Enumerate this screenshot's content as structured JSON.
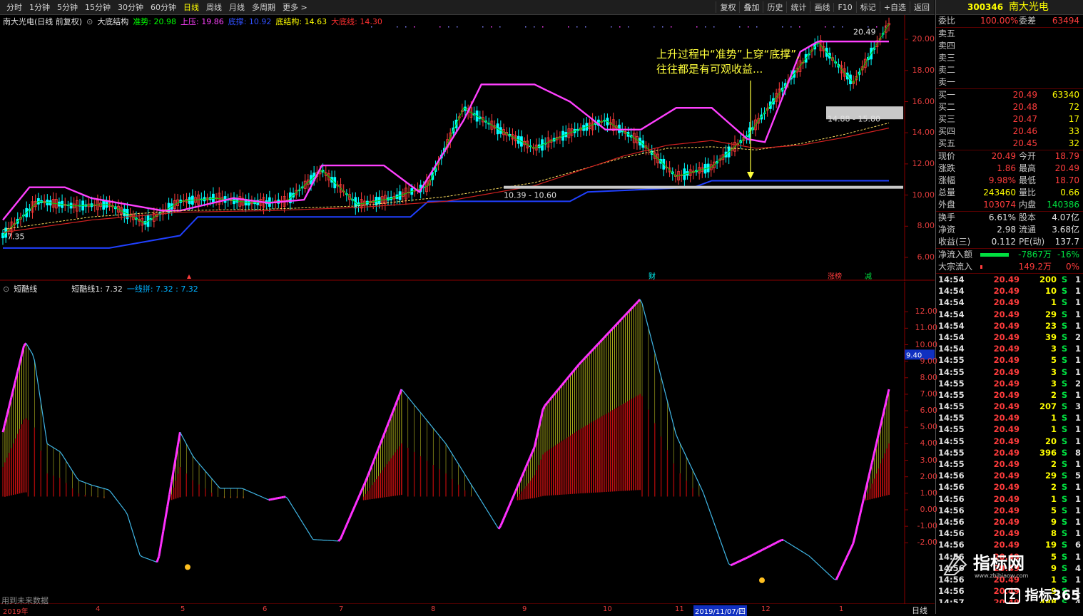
{
  "toolbar": {
    "tabs": [
      "分时",
      "1分钟",
      "5分钟",
      "15分钟",
      "30分钟",
      "60分钟",
      "日线",
      "周线",
      "月线",
      "多周期",
      "更多 >"
    ],
    "active_tab": "日线",
    "buttons": [
      "复权",
      "叠加",
      "历史",
      "统计",
      "画线",
      "F10",
      "标记",
      "+自选",
      "返回"
    ]
  },
  "main_legend": {
    "title": "南大光电(日线 前复权)",
    "indicator": "大底结构",
    "items": [
      {
        "text": "准势: 20.98",
        "color": "#00ff00"
      },
      {
        "text": "上压: 19.86",
        "color": "#ff40ff"
      },
      {
        "text": "底撑: 10.92",
        "color": "#3050ff"
      },
      {
        "text": "底结构: 14.63",
        "color": "#ffff00"
      },
      {
        "text": "大底线: 14.30",
        "color": "#ff3030"
      }
    ]
  },
  "annotation": [
    "上升过程中“准势”上穿“底撑”,",
    "往往都是有可观收益..."
  ],
  "main_axis_labels": [
    "20.00",
    "18.00",
    "16.00",
    "14.00",
    "12.00",
    "10.00",
    "8.00",
    "6.00"
  ],
  "price_marks": {
    "high": "20.49",
    "low": "7.35",
    "zone_high": "14.88 - 15.80",
    "zone_low": "10.39 - 10.60"
  },
  "event_tags": [
    "财",
    "涨榜",
    "减"
  ],
  "indicator_legend": {
    "name": "短酷线",
    "items": [
      {
        "text": "短酷线1: 7.32",
        "color": "#e0e0e0"
      },
      {
        "text": "一线拼: 7.32 : 7.32",
        "color": "#00b0ff"
      }
    ]
  },
  "ind_axis_labels": [
    "12.00",
    "11.00",
    "10.00",
    "9.00",
    "8.00",
    "7.00",
    "6.00",
    "5.00",
    "4.00",
    "3.00",
    "2.00",
    "1.00",
    "0.00",
    "-1.00",
    "-2.00"
  ],
  "ind_marker": "9.40",
  "date_labels": [
    "2019年",
    "4",
    "5",
    "6",
    "7",
    "8",
    "9",
    "10",
    "11",
    "2019/11/07/四",
    "12",
    "1"
  ],
  "bottom_note": "用到未来数据",
  "right_bottom_tab": "日线",
  "quote": {
    "code": "300346",
    "name": "南大光电",
    "weibi_label": "委比",
    "weibi": "100.00%",
    "weicha_label": "委差",
    "weicha": "63494",
    "sell": [
      [
        "卖五",
        ""
      ],
      [
        "卖四",
        ""
      ],
      [
        "卖三",
        ""
      ],
      [
        "卖二",
        ""
      ],
      [
        "卖一",
        ""
      ]
    ],
    "buy": [
      [
        "买一",
        "20.49",
        "63340"
      ],
      [
        "买二",
        "20.48",
        "72"
      ],
      [
        "买三",
        "20.47",
        "17"
      ],
      [
        "买四",
        "20.46",
        "33"
      ],
      [
        "买五",
        "20.45",
        "32"
      ]
    ],
    "stats": [
      [
        "现价",
        "20.49",
        "今开",
        "18.79"
      ],
      [
        "涨跌",
        "1.86",
        "最高",
        "20.49"
      ],
      [
        "涨幅",
        "9.98%",
        "最低",
        "18.70"
      ],
      [
        "总量",
        "243460",
        "量比",
        "0.66"
      ],
      [
        "外盘",
        "103074",
        "内盘",
        "140386"
      ],
      [
        "换手",
        "6.61%",
        "股本",
        "4.07亿"
      ],
      [
        "净资",
        "2.98",
        "流通",
        "3.68亿"
      ],
      [
        "收益(三)",
        "0.112",
        "PE(动)",
        "137.7"
      ]
    ],
    "netflow_label": "净流入额",
    "netflow": "-7867万",
    "netflow_pct": "-16%",
    "bigflow_label": "大宗流入",
    "bigflow": "149.2万",
    "bigflow_pct": "0%"
  },
  "ticks": [
    [
      "14:54",
      "20.49",
      "200",
      "S",
      "1"
    ],
    [
      "14:54",
      "20.49",
      "10",
      "S",
      "1"
    ],
    [
      "14:54",
      "20.49",
      "1",
      "S",
      "1"
    ],
    [
      "14:54",
      "20.49",
      "29",
      "S",
      "1"
    ],
    [
      "14:54",
      "20.49",
      "23",
      "S",
      "1"
    ],
    [
      "14:54",
      "20.49",
      "39",
      "S",
      "2"
    ],
    [
      "14:54",
      "20.49",
      "3",
      "S",
      "1"
    ],
    [
      "14:55",
      "20.49",
      "5",
      "S",
      "1"
    ],
    [
      "14:55",
      "20.49",
      "3",
      "S",
      "1"
    ],
    [
      "14:55",
      "20.49",
      "3",
      "S",
      "2"
    ],
    [
      "14:55",
      "20.49",
      "2",
      "S",
      "1"
    ],
    [
      "14:55",
      "20.49",
      "207",
      "S",
      "3"
    ],
    [
      "14:55",
      "20.49",
      "1",
      "S",
      "1"
    ],
    [
      "14:55",
      "20.49",
      "1",
      "S",
      "1"
    ],
    [
      "14:55",
      "20.49",
      "20",
      "S",
      "1"
    ],
    [
      "14:55",
      "20.49",
      "396",
      "S",
      "8"
    ],
    [
      "14:55",
      "20.49",
      "2",
      "S",
      "1"
    ],
    [
      "14:56",
      "20.49",
      "29",
      "S",
      "5"
    ],
    [
      "14:56",
      "20.49",
      "2",
      "S",
      "1"
    ],
    [
      "14:56",
      "20.49",
      "1",
      "S",
      "1"
    ],
    [
      "14:56",
      "20.49",
      "5",
      "S",
      "1"
    ],
    [
      "14:56",
      "20.49",
      "9",
      "S",
      "1"
    ],
    [
      "14:56",
      "20.49",
      "8",
      "S",
      "1"
    ],
    [
      "14:56",
      "20.49",
      "19",
      "S",
      "6"
    ],
    [
      "14:56",
      "20.49",
      "5",
      "S",
      "1"
    ],
    [
      "14:56",
      "20.49",
      "9",
      "S",
      "4"
    ],
    [
      "14:56",
      "20.49",
      "1",
      "S",
      "1"
    ],
    [
      "14:56",
      "20.49",
      "9",
      "S",
      "1"
    ],
    [
      "14:57",
      "20.49",
      "488",
      "S",
      "4"
    ],
    [
      "15:00",
      "20.49",
      "958",
      "S",
      "4"
    ]
  ],
  "watermark": {
    "line1": "指标网",
    "line2": "www.zhibiaow.com",
    "line3": "指标365"
  },
  "colors": {
    "up": "#ff3c3c",
    "down": "#00ffff",
    "magenta": "#ff40ff",
    "blue": "#2040ff",
    "yellow": "#ffff3c"
  },
  "chart_data": [
    {
      "type": "candlestick",
      "title": "南大光电(日线 前复权)",
      "ylim": [
        6,
        21
      ],
      "series": [
        {
          "name": "准势",
          "x": [
            0,
            0.04,
            0.08,
            0.12,
            0.16,
            0.2,
            0.24,
            0.28,
            0.32,
            0.36,
            0.4,
            0.44,
            0.48,
            0.52,
            0.56,
            0.6,
            0.64,
            0.68,
            0.72,
            0.76,
            0.8,
            0.84,
            0.88,
            0.92,
            0.96,
            1
          ],
          "values": [
            7.4,
            9.6,
            9.3,
            9.4,
            8.2,
            9.6,
            9.8,
            9.5,
            9.6,
            11.6,
            9.4,
            9.8,
            10.6,
            15.6,
            14.2,
            13.0,
            14.0,
            14.8,
            13.4,
            11.2,
            11.8,
            13.8,
            16.8,
            19.8,
            17.2,
            20.98
          ]
        },
        {
          "name": "上压",
          "x": [
            0,
            0.03,
            0.07,
            0.1,
            0.18,
            0.2,
            0.26,
            0.3,
            0.34,
            0.36,
            0.43,
            0.47,
            0.52,
            0.54,
            0.6,
            0.64,
            0.68,
            0.72,
            0.76,
            0.8,
            0.84,
            0.86,
            0.9,
            0.92,
            1
          ],
          "values": [
            8.4,
            10.5,
            10.5,
            9.8,
            9.0,
            9.0,
            9.8,
            9.5,
            9.7,
            11.9,
            11.9,
            10.2,
            14.8,
            17.1,
            17.1,
            16.0,
            14.2,
            14.2,
            15.6,
            15.6,
            13.6,
            13.4,
            19.2,
            19.86,
            19.86
          ]
        },
        {
          "name": "底撑",
          "x": [
            0,
            0.12,
            0.2,
            0.22,
            0.46,
            0.48,
            0.64,
            0.66,
            0.78,
            0.8,
            0.82,
            1
          ],
          "values": [
            6.6,
            6.6,
            7.4,
            8.6,
            8.6,
            9.6,
            9.6,
            10.2,
            10.5,
            10.92,
            10.92,
            10.92
          ]
        },
        {
          "name": "底结构",
          "x": [
            0,
            0.1,
            0.2,
            0.3,
            0.4,
            0.5,
            0.6,
            0.7,
            0.75,
            0.8,
            0.85,
            0.9,
            0.95,
            1
          ],
          "values": [
            7.8,
            8.6,
            9.0,
            9.1,
            9.3,
            9.9,
            10.8,
            12.4,
            13.0,
            13.1,
            12.9,
            13.3,
            13.9,
            14.63
          ]
        },
        {
          "name": "大底线",
          "x": [
            0,
            0.1,
            0.2,
            0.3,
            0.4,
            0.5,
            0.6,
            0.7,
            0.75,
            0.8,
            0.85,
            0.9,
            0.95,
            1
          ],
          "values": [
            7.6,
            8.4,
            8.9,
            9.0,
            9.2,
            9.6,
            10.6,
            12.5,
            13.2,
            13.5,
            13.0,
            13.2,
            13.7,
            14.3
          ]
        }
      ]
    },
    {
      "type": "line",
      "title": "短酷线",
      "ylim": [
        -4.4,
        13.3
      ],
      "series": [
        {
          "name": "短酷线1",
          "x": [
            0,
            0.025,
            0.035,
            0.05,
            0.065,
            0.085,
            0.1,
            0.12,
            0.14,
            0.155,
            0.175,
            0.2,
            0.215,
            0.245,
            0.27,
            0.3,
            0.32,
            0.35,
            0.38,
            0.41,
            0.45,
            0.5,
            0.53,
            0.56,
            0.6,
            0.61,
            0.65,
            0.72,
            0.76,
            0.79,
            0.82,
            0.84,
            0.88,
            0.91,
            0.94,
            0.96,
            1
          ],
          "values": [
            4.7,
            10.2,
            9.3,
            4.0,
            3.5,
            1.8,
            1.5,
            1.2,
            -0.2,
            -2.8,
            -3.2,
            4.7,
            3.2,
            1.3,
            1.3,
            0.6,
            0.8,
            -1.8,
            -1.9,
            1.8,
            7.3,
            4.0,
            1.4,
            -1.2,
            3.8,
            6.2,
            8.8,
            12.8,
            4.5,
            1.1,
            -3.4,
            -2.9,
            -1.8,
            -2.8,
            -4.3,
            -2.0,
            7.3
          ]
        }
      ]
    }
  ]
}
